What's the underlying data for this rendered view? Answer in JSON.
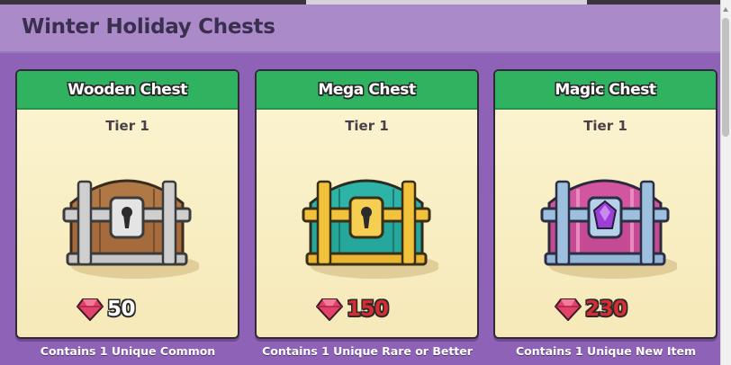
{
  "page": {
    "title": "Winter Holiday Chests"
  },
  "chests": [
    {
      "name": "Wooden Chest",
      "tier": "Tier 1",
      "price": "50",
      "price_color": "#ffffff",
      "description": "Contains 1 Unique Common",
      "icon": "wooden-chest-icon"
    },
    {
      "name": "Mega Chest",
      "tier": "Tier 1",
      "price": "150",
      "price_color": "#d62d33",
      "description": "Contains 1 Unique Rare or Better",
      "icon": "mega-chest-icon"
    },
    {
      "name": "Magic Chest",
      "tier": "Tier 1",
      "price": "230",
      "price_color": "#d62d33",
      "description": "Contains 1 Unique New Item",
      "icon": "magic-chest-icon"
    }
  ],
  "currency_icon": "ruby-gem-icon",
  "colors": {
    "header_bg": "#ab8ac9",
    "page_bg": "#8e63b7",
    "card_header": "#2fb360"
  }
}
